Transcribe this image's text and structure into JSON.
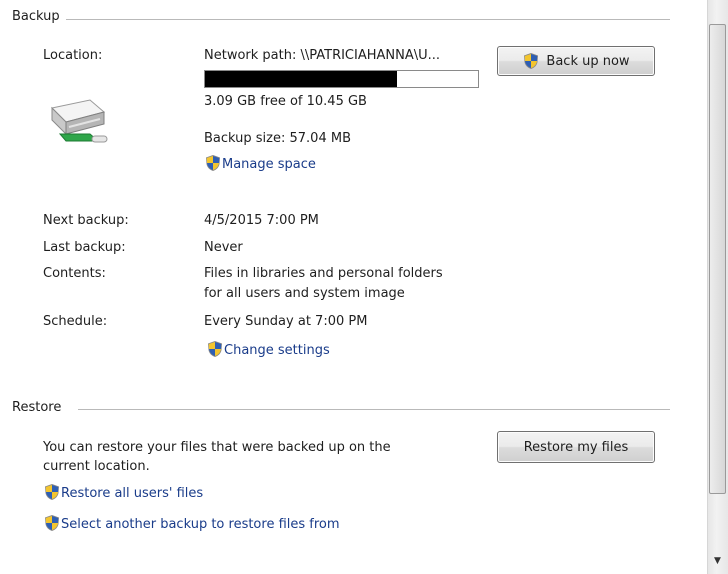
{
  "backup": {
    "section_title": "Backup",
    "location_label": "Location:",
    "location_value": "Network path: \\\\PATRICIAHANNA\\U...",
    "disk_usage_fraction": 0.705,
    "free_space": "3.09 GB free of 10.45 GB",
    "backup_size": "Backup size: 57.04 MB",
    "manage_space_link": "Manage space",
    "back_up_now_button": "Back up now",
    "next_backup_label": "Next backup:",
    "next_backup_value": "4/5/2015 7:00 PM",
    "last_backup_label": "Last backup:",
    "last_backup_value": "Never",
    "contents_label": "Contents:",
    "contents_line1": "Files in libraries and personal folders",
    "contents_line2": "for all users and system image",
    "schedule_label": "Schedule:",
    "schedule_value": "Every Sunday at 7:00 PM",
    "change_settings_link": "Change settings"
  },
  "restore": {
    "section_title": "Restore",
    "description_line1": "You can restore your files that were backed up on the",
    "description_line2": "current location.",
    "restore_my_files_button": "Restore my files",
    "restore_all_users_link": "Restore all users' files",
    "select_another_backup_link": "Select another backup to restore files from"
  },
  "colors": {
    "link": "#1a3c8a",
    "shield_blue": "#2f5fb3",
    "shield_yellow": "#f3c52e"
  },
  "icons": {
    "drive": "network-drive-icon",
    "uac": "uac-shield-icon"
  }
}
